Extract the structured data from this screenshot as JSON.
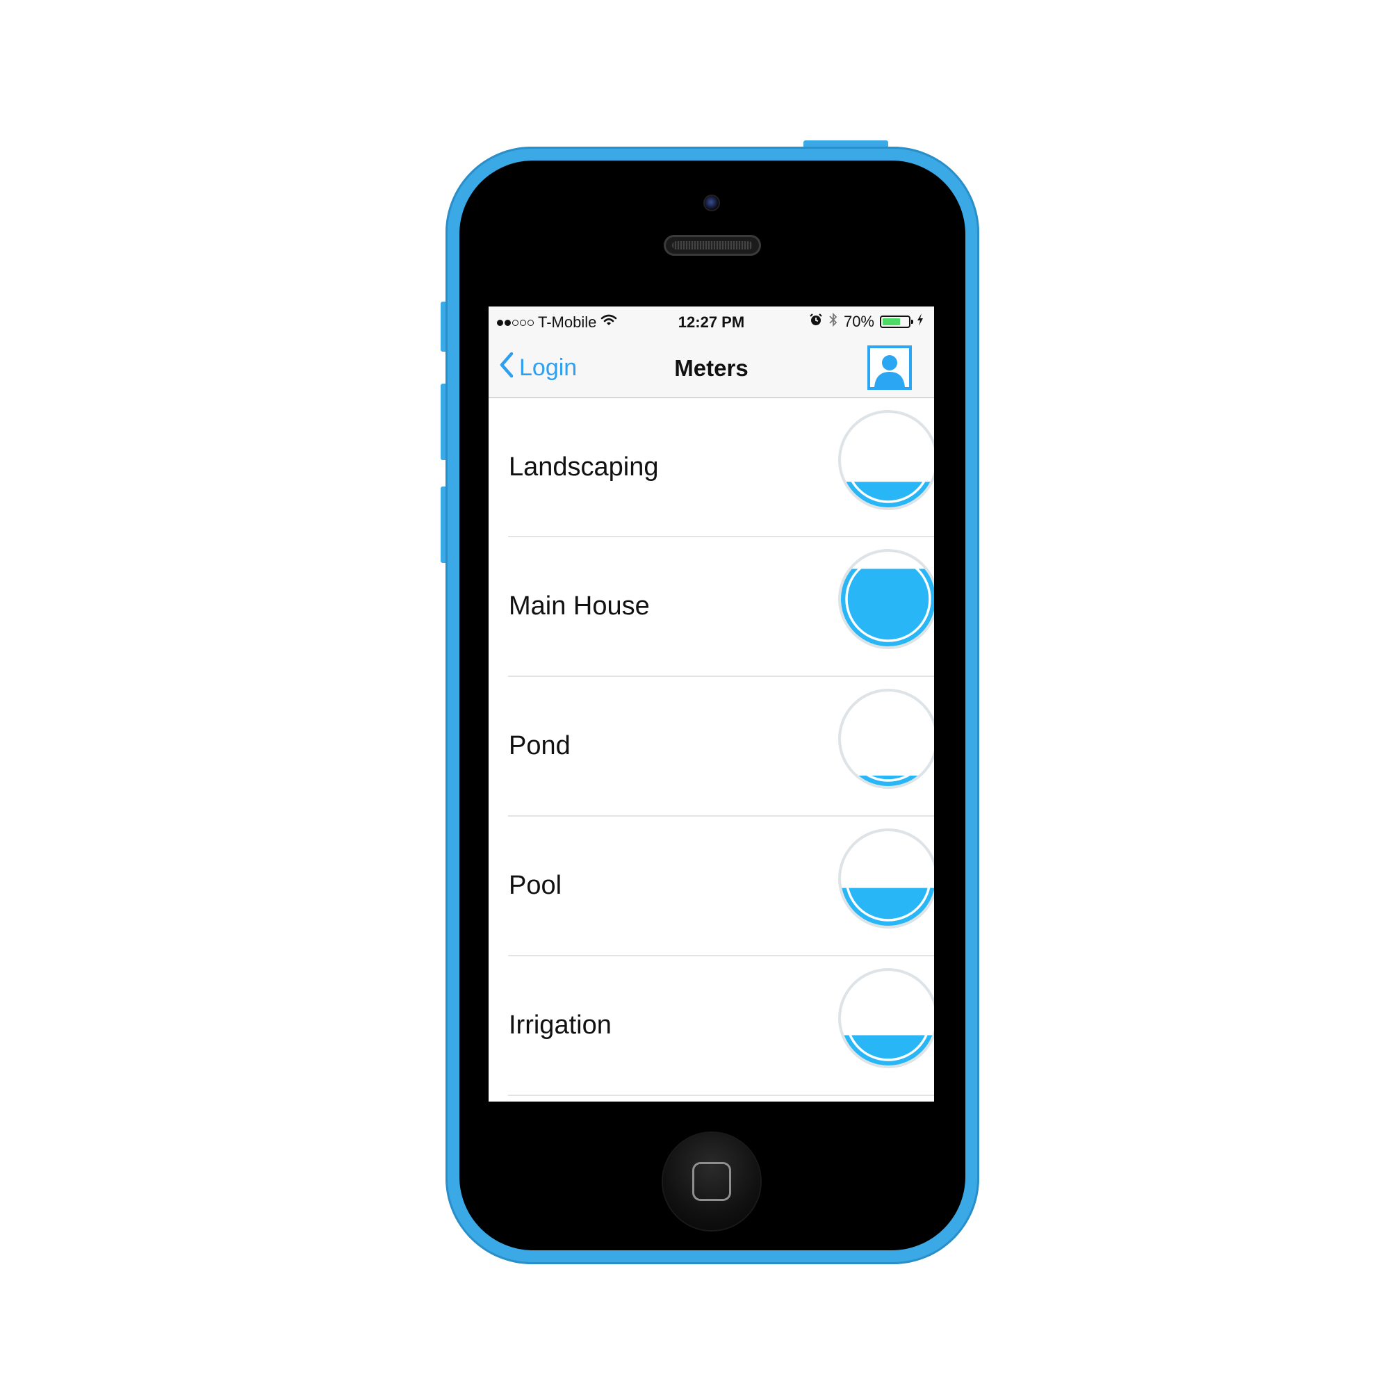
{
  "colors": {
    "device_frame": "#3aa9e6",
    "accent": "#2f9ff0",
    "gauge_fill": "#29b6f6",
    "gauge_ring": "#dde3e6"
  },
  "status_bar": {
    "signal_bars_filled": 2,
    "signal_bars_total": 5,
    "carrier": "T-Mobile",
    "wifi_icon": "wifi-icon",
    "time": "12:27 PM",
    "alarm_icon": "alarm-icon",
    "bluetooth_icon": "bluetooth-icon",
    "battery_percent": "70%",
    "battery_level": 0.7,
    "charging_icon": "charging-bolt-icon"
  },
  "nav": {
    "back_label": "Login",
    "back_icon": "chevron-left-icon",
    "title": "Meters",
    "profile_icon": "user-icon"
  },
  "meters": [
    {
      "name": "Landscaping",
      "level": 0.27
    },
    {
      "name": "Main House",
      "level": 0.82
    },
    {
      "name": "Pond",
      "level": 0.11
    },
    {
      "name": "Pool",
      "level": 0.4
    },
    {
      "name": "Irrigation",
      "level": 0.32
    }
  ]
}
